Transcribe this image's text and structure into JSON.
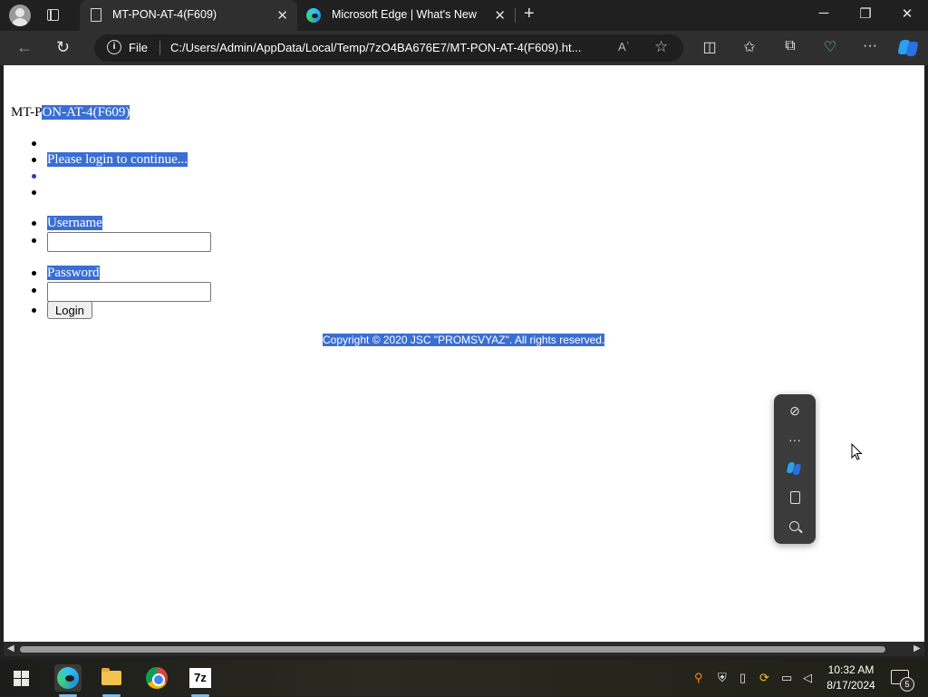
{
  "browser": {
    "tabs": [
      {
        "title": "MT-PON-AT-4(F609)",
        "icon": "page-icon"
      },
      {
        "title": "Microsoft Edge | What's New",
        "icon": "edge-icon"
      }
    ],
    "address_bar": {
      "scheme_label": "File",
      "url": "C:/Users/Admin/AppData/Local/Temp/7zO4BA676E7/MT-PON-AT-4(F609).ht...",
      "read_aloud_label": "Aʾ"
    }
  },
  "page": {
    "heading_prefix": "MT-P",
    "heading_selected": "ON-AT-4(F609)",
    "login_prompt": "Please login to continue...",
    "username_label": "Username",
    "username_value": "",
    "password_label": "Password",
    "password_value": "",
    "login_button": "Login",
    "copyright": "Copyright © 2020 JSC \"PROMSVYAZ\". All rights reserved."
  },
  "taskbar": {
    "apps": [
      "edge",
      "file-explorer",
      "chrome",
      "7-zip"
    ],
    "sevenzip_label": "7z",
    "time": "10:32 AM",
    "date": "8/17/2024",
    "notification_count": "5"
  },
  "colors": {
    "selection": "#3a6ed4",
    "chrome_dark": "#202020",
    "toolbar": "#2f2f2f"
  }
}
